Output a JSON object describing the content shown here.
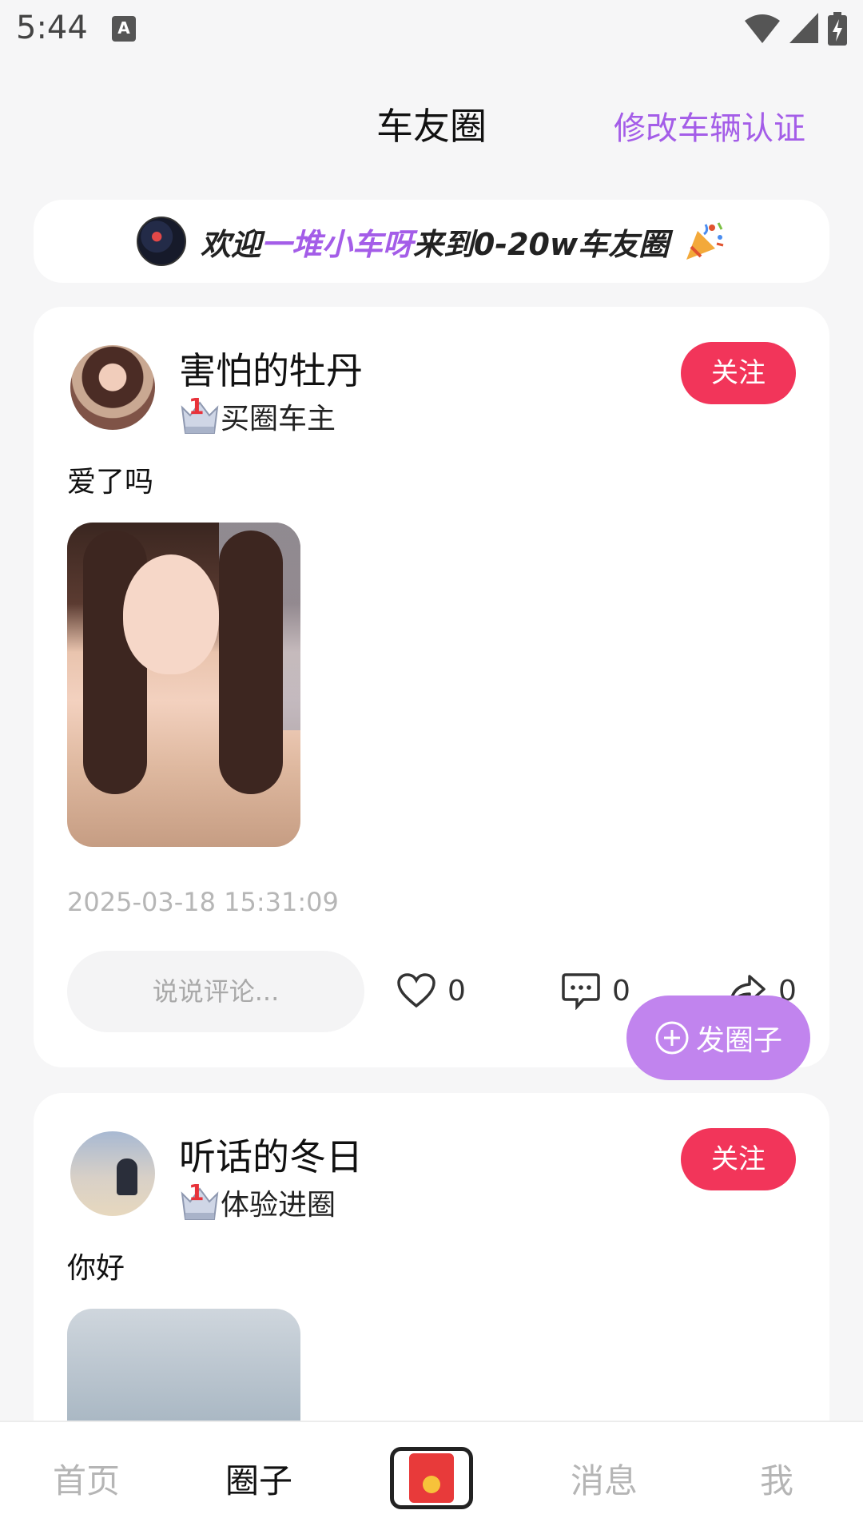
{
  "status_bar": {
    "time": "5:44",
    "note_badge": "A"
  },
  "header": {
    "title": "车友圈",
    "action_label": "修改车辆认证"
  },
  "welcome": {
    "prefix": "欢迎",
    "username": "一堆小车呀",
    "suffix": "来到0-20w车友圈"
  },
  "posts": [
    {
      "username": "害怕的牡丹",
      "rank_number": "1",
      "rank_label": "买圈车主",
      "follow_label": "关注",
      "text": "爱了吗",
      "timestamp": "2025-03-18 15:31:09",
      "comment_placeholder": "说说评论...",
      "likes": "0",
      "comments": "0",
      "shares": "0"
    },
    {
      "username": "听话的冬日",
      "rank_number": "1",
      "rank_label": "体验进圈",
      "follow_label": "关注",
      "text": "你好"
    }
  ],
  "fab": {
    "label": "发圈子"
  },
  "bottom_nav": {
    "home": "首页",
    "circle": "圈子",
    "messages": "消息",
    "me": "我"
  },
  "colors": {
    "accent": "#a45de8",
    "follow": "#f2355a",
    "fab": "#c184ee"
  }
}
